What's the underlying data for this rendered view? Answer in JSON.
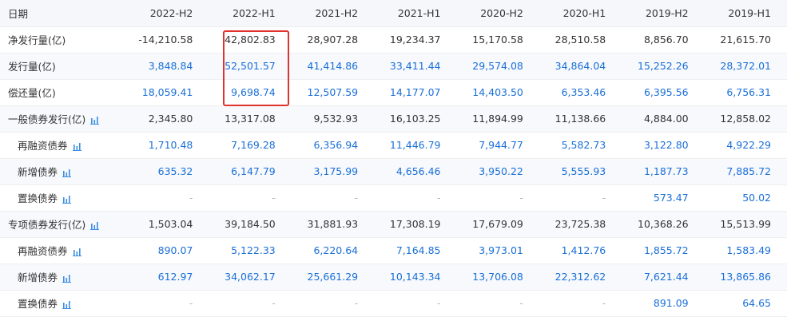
{
  "header": {
    "label": "日期",
    "periods": [
      "2022-H2",
      "2022-H1",
      "2021-H2",
      "2021-H1",
      "2020-H2",
      "2020-H1",
      "2019-H2",
      "2019-H1"
    ]
  },
  "rows": [
    {
      "label": "净发行量(亿)",
      "style": "plain",
      "chart_icon": false,
      "sub": false,
      "values": [
        "-14,210.58",
        "42,802.83",
        "28,907.28",
        "19,234.37",
        "15,170.58",
        "28,510.58",
        "8,856.70",
        "21,615.70"
      ]
    },
    {
      "label": "发行量(亿)",
      "style": "blue",
      "chart_icon": false,
      "sub": false,
      "values": [
        "3,848.84",
        "52,501.57",
        "41,414.86",
        "33,411.44",
        "29,574.08",
        "34,864.04",
        "15,252.26",
        "28,372.01"
      ]
    },
    {
      "label": "偿还量(亿)",
      "style": "blue",
      "chart_icon": false,
      "sub": false,
      "values": [
        "18,059.41",
        "9,698.74",
        "12,507.59",
        "14,177.07",
        "14,403.50",
        "6,353.46",
        "6,395.56",
        "6,756.31"
      ]
    },
    {
      "label": "一般债券发行(亿)",
      "style": "plain",
      "chart_icon": true,
      "sub": false,
      "values": [
        "2,345.80",
        "13,317.08",
        "9,532.93",
        "16,103.25",
        "11,894.99",
        "11,138.66",
        "4,884.00",
        "12,858.02"
      ]
    },
    {
      "label": "再融资债券",
      "style": "blue",
      "chart_icon": true,
      "sub": true,
      "values": [
        "1,710.48",
        "7,169.28",
        "6,356.94",
        "11,446.79",
        "7,944.77",
        "5,582.73",
        "3,122.80",
        "4,922.29"
      ]
    },
    {
      "label": "新增债券",
      "style": "blue",
      "chart_icon": true,
      "sub": true,
      "values": [
        "635.32",
        "6,147.79",
        "3,175.99",
        "4,656.46",
        "3,950.22",
        "5,555.93",
        "1,187.73",
        "7,885.72"
      ]
    },
    {
      "label": "置换债券",
      "style": "blue",
      "chart_icon": true,
      "sub": true,
      "values": [
        "-",
        "-",
        "-",
        "-",
        "-",
        "-",
        "573.47",
        "50.02"
      ]
    },
    {
      "label": "专项债券发行(亿)",
      "style": "plain",
      "chart_icon": true,
      "sub": false,
      "values": [
        "1,503.04",
        "39,184.50",
        "31,881.93",
        "17,308.19",
        "17,679.09",
        "23,725.38",
        "10,368.26",
        "15,513.99"
      ]
    },
    {
      "label": "再融资债券",
      "style": "blue",
      "chart_icon": true,
      "sub": true,
      "values": [
        "890.07",
        "5,122.33",
        "6,220.64",
        "7,164.85",
        "3,973.01",
        "1,412.76",
        "1,855.72",
        "1,583.49"
      ]
    },
    {
      "label": "新增债券",
      "style": "blue",
      "chart_icon": true,
      "sub": true,
      "values": [
        "612.97",
        "34,062.17",
        "25,661.29",
        "10,143.34",
        "13,706.08",
        "22,312.62",
        "7,621.44",
        "13,865.86"
      ]
    },
    {
      "label": "置换债券",
      "style": "blue",
      "chart_icon": true,
      "sub": true,
      "values": [
        "-",
        "-",
        "-",
        "-",
        "-",
        "-",
        "891.09",
        "64.65"
      ]
    }
  ],
  "colors": {
    "value_blue": "#1a6fd8",
    "text_default": "#333333",
    "header_bg": "#f5f7fa",
    "highlight_border": "#e0332e",
    "chart_icon": "#3a8ee6"
  },
  "icons": {
    "chart": "bar-chart-icon"
  }
}
